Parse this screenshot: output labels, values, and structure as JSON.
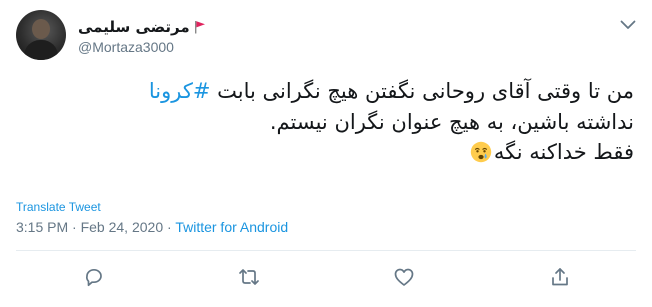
{
  "user": {
    "display_name": "مرتضی سلیمی",
    "handle": "@Mortaza3000"
  },
  "tweet": {
    "line1_text": "من تا وقتی آقای روحانی نگفتن هیچ نگرانی بابت ",
    "hashtag": "#کرونا",
    "line2": "نداشته باشین، به هیچ عنوان نگران نیستم.",
    "line3": "فقط خداکنه نگه"
  },
  "translate_label": "Translate Tweet",
  "meta": {
    "time": "3:15 PM",
    "separator": " · ",
    "date": "Feb 24, 2020",
    "source": "Twitter for Android"
  },
  "icons": {
    "caret": "chevron-down-icon",
    "flag": "red-flag-icon",
    "emoji": "crying-face-icon",
    "reply": "reply-icon",
    "retweet": "retweet-icon",
    "like": "heart-icon",
    "share": "share-icon"
  },
  "colors": {
    "link": "#1b95e0",
    "secondary": "#657786",
    "text": "#14171a",
    "flag": "#e0245e"
  }
}
